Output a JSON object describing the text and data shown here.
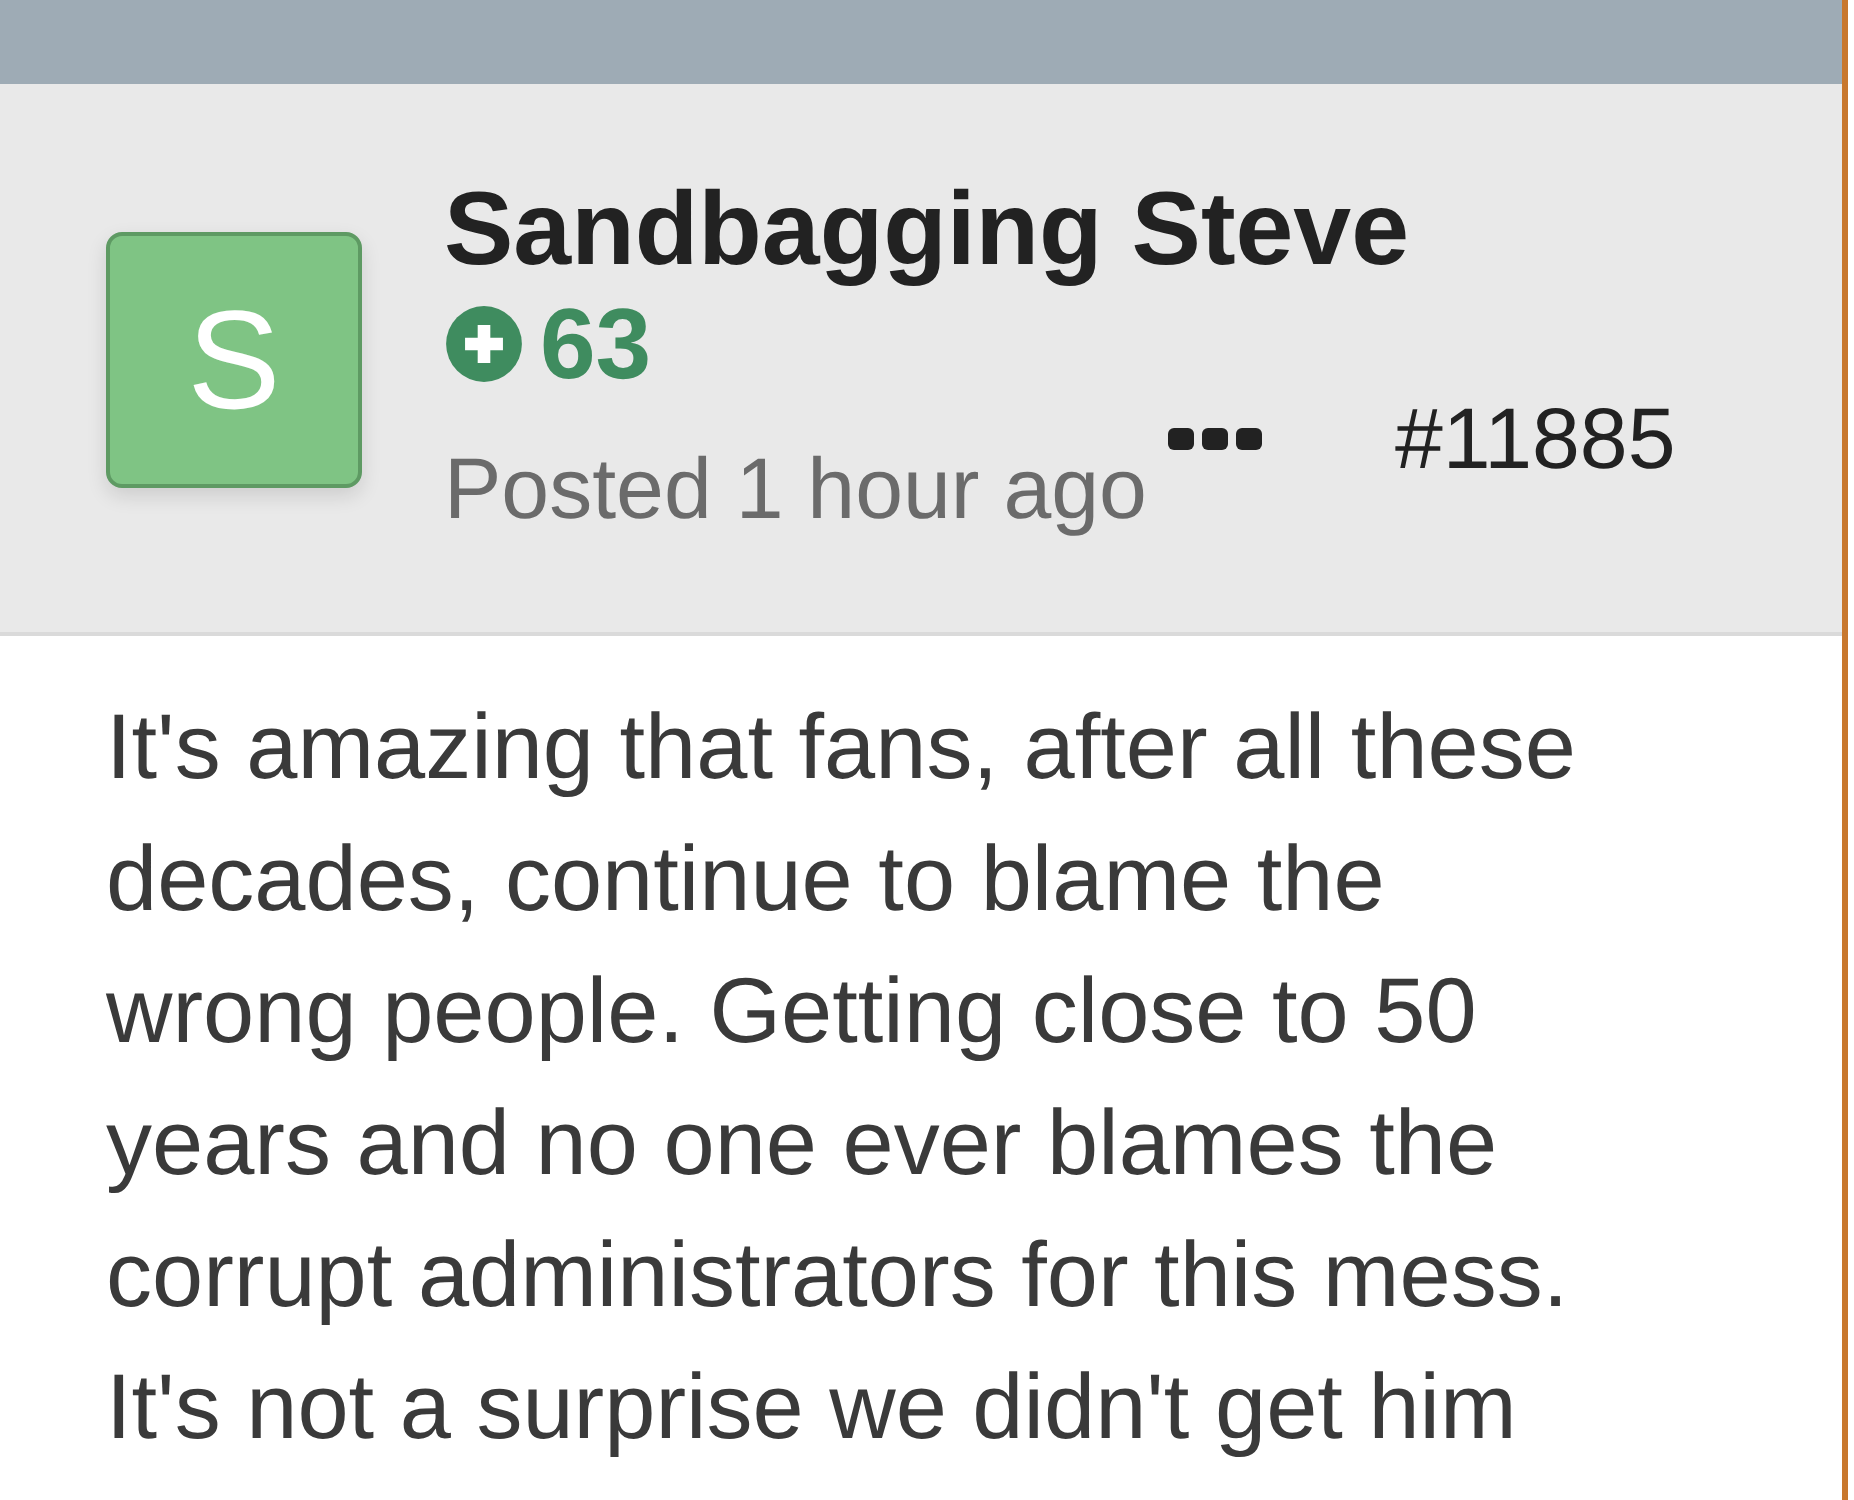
{
  "post": {
    "author": "Sandbagging Steve",
    "avatar_letter": "S",
    "reputation": "63",
    "posted": "Posted 1 hour ago",
    "number": "#11885",
    "body": "It's amazing that fans, after all these decades, continue to blame the wrong people. Getting close to 50 years and no one ever blames the corrupt administrators for this mess. It's not a surprise we didn't get him"
  }
}
